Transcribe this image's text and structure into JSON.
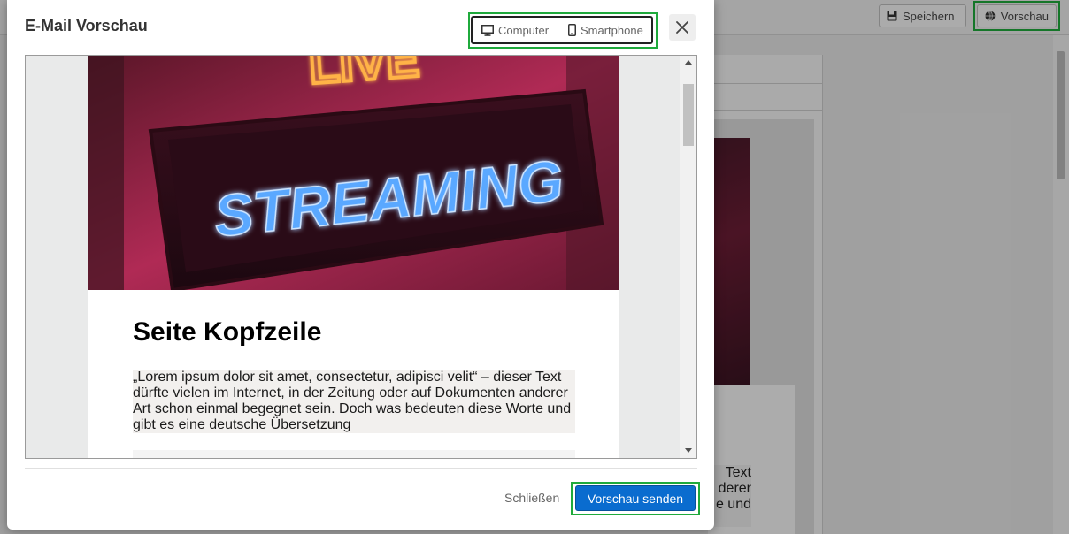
{
  "background": {
    "save_label": "Speichern",
    "preview_label": "Vorschau",
    "text_fragment_lines": [
      "Text",
      "derer",
      "e und"
    ]
  },
  "modal": {
    "title": "E-Mail Vorschau",
    "device_toggle": {
      "computer_label": "Computer",
      "smartphone_label": "Smartphone"
    },
    "close_icon": "close-icon",
    "email": {
      "hero_line1": "LIVE",
      "hero_line2": "STREAMING",
      "heading": "Seite Kopfzeile",
      "paragraph": "„Lorem ipsum dolor sit amet, consectetur, adipisci velit“ – dieser Text dürfte vielen im Internet, in der Zeitung oder auf Dokumenten anderer Art schon einmal begegnet sein. Doch was bedeuten diese Worte und gibt es eine deutsche Übersetzung"
    },
    "footer": {
      "close_label": "Schließen",
      "send_label": "Vorschau senden"
    }
  },
  "colors": {
    "primary": "#0a6ccf",
    "highlight": "#1faa3c"
  }
}
